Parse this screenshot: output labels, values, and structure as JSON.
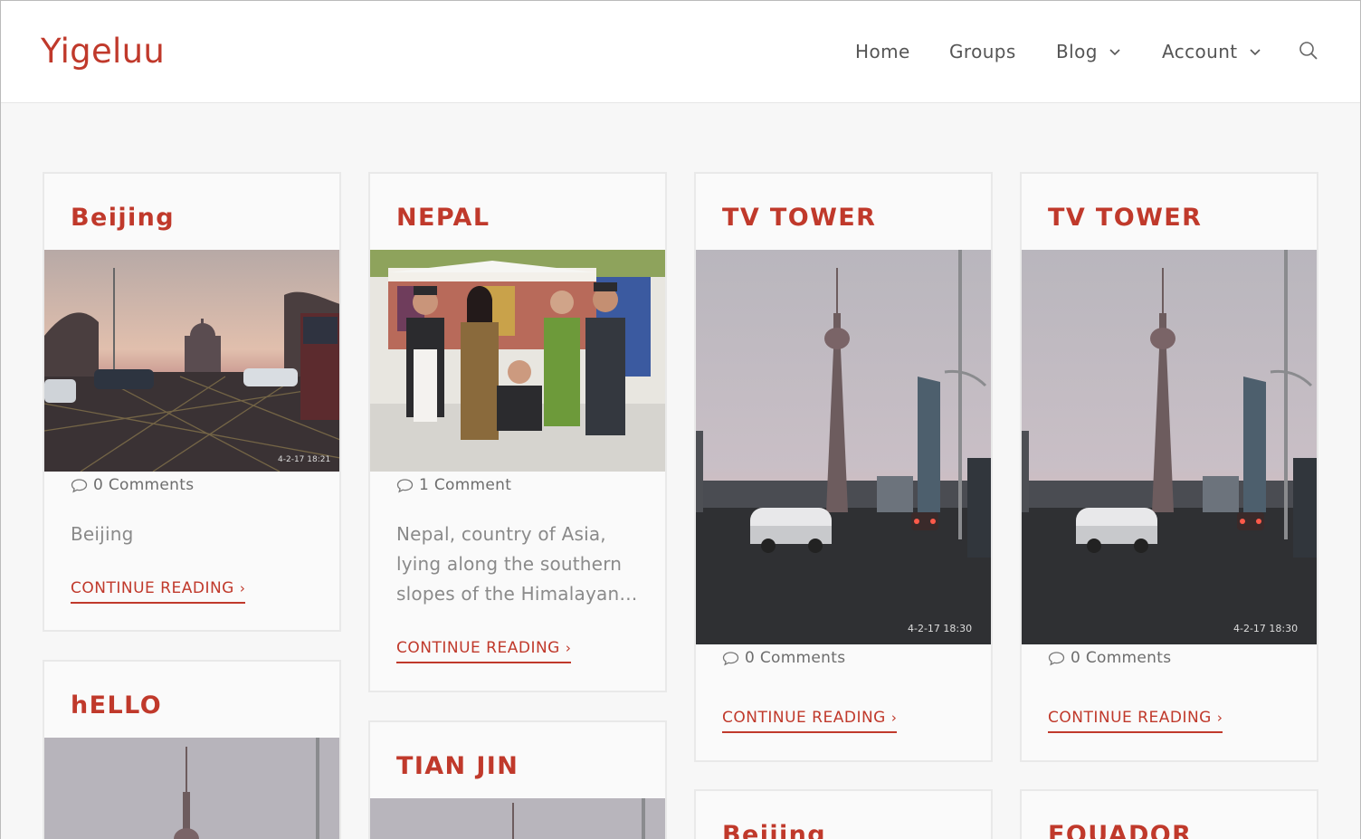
{
  "site": {
    "logo": "Yigeluu"
  },
  "nav": {
    "items": [
      {
        "label": "Home"
      },
      {
        "label": "Groups"
      },
      {
        "label": "Blog",
        "dropdown": true
      },
      {
        "label": "Account",
        "dropdown": true
      }
    ],
    "search_icon": "search-icon"
  },
  "posts": [
    {
      "title": "Beijing",
      "comments": "0 Comments",
      "excerpt": "Beijing",
      "more": "CONTINUE READING",
      "stamp": "4-2-17 18:21"
    },
    {
      "title": "NEPAL",
      "comments": "1 Comment",
      "excerpt": "Nepal, country of Asia, lying along the southern slopes of the Himalayan…",
      "more": "CONTINUE READING"
    },
    {
      "title": "TV TOWER",
      "comments": "0 Comments",
      "more": "CONTINUE READING",
      "stamp": "4-2-17 18:30"
    },
    {
      "title": "TV TOWER",
      "comments": "0 Comments",
      "more": "CONTINUE READING",
      "stamp": "4-2-17 18:30"
    },
    {
      "title": "hELLO"
    },
    {
      "title": "TIAN JIN"
    },
    {
      "title": "Beijing"
    },
    {
      "title": "EQUADOR"
    }
  ],
  "colors": {
    "accent": "#c0392b",
    "text": "#555555",
    "muted": "#8a8a8a",
    "background": "#f7f7f7"
  }
}
